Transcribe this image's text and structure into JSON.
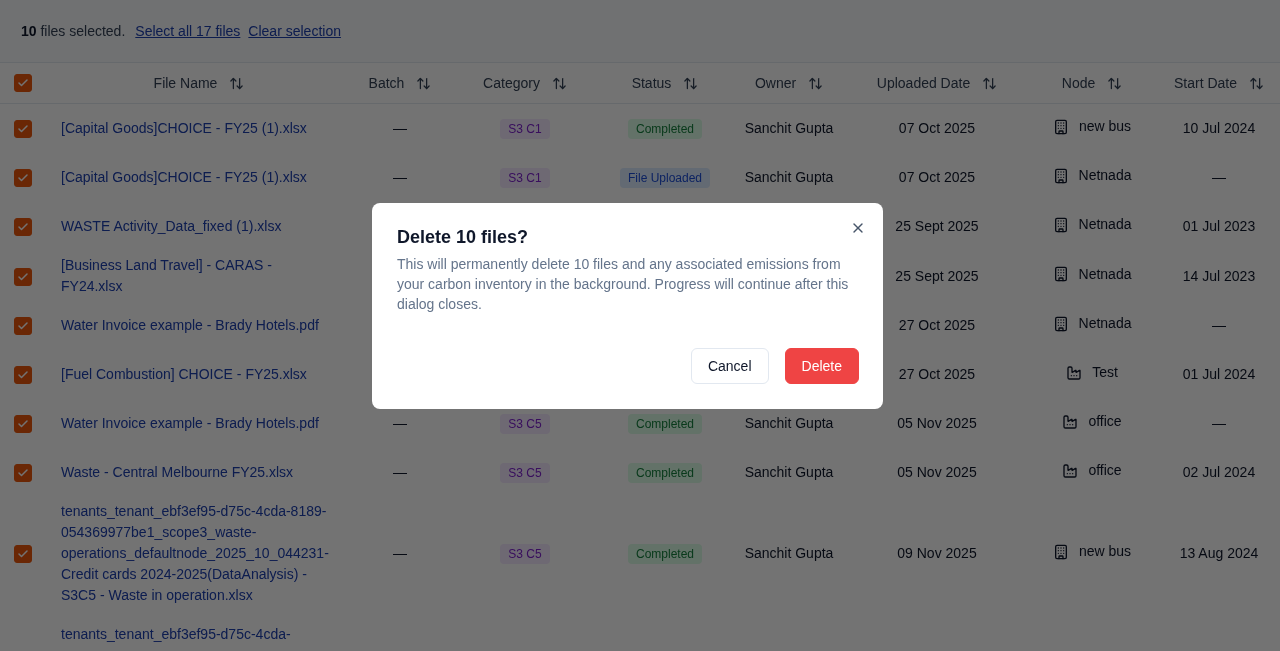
{
  "selection_bar": {
    "summary": "**10** files selected.",
    "links": [
      "Select all 17 files",
      "Clear selection"
    ]
  },
  "table": {
    "header_checked": true,
    "columns": [
      "File Name",
      "Batch",
      "Category",
      "Status",
      "Owner",
      "Uploaded Date",
      "Node",
      "Start Date"
    ],
    "rows": [
      {
        "checked": true,
        "file_name": "[Capital Goods]CHOICE - FY25 (1).xlsx",
        "batch": "—",
        "category": "S3 C1",
        "status": {
          "label": "Completed",
          "kind": "completed"
        },
        "owner": "Sanchit Gupta",
        "uploaded": "07 Oct 2025",
        "node": {
          "kind": "building",
          "label": "new bus"
        },
        "start_date": "10 Jul 2024"
      },
      {
        "checked": true,
        "file_name": "[Capital Goods]CHOICE - FY25 (1).xlsx",
        "batch": "—",
        "category": "S3 C1",
        "status": {
          "label": "File Uploaded",
          "kind": "uploaded"
        },
        "owner": "Sanchit Gupta",
        "uploaded": "07 Oct 2025",
        "node": {
          "kind": "building",
          "label": "Netnada"
        },
        "start_date": "—"
      },
      {
        "checked": true,
        "file_name": "WASTE Activity_Data_fixed (1).xlsx",
        "uploaded": "25 Sept 2025",
        "node": {
          "kind": "building",
          "label": "Netnada"
        },
        "start_date": "01 Jul 2023"
      },
      {
        "checked": true,
        "file_name": "[Business Land Travel] - CARAS - FY24.xlsx",
        "uploaded": "25 Sept 2025",
        "node": {
          "kind": "building",
          "label": "Netnada"
        },
        "start_date": "14 Jul 2023"
      },
      {
        "checked": true,
        "file_name": "Water Invoice example - Brady Hotels.pdf",
        "uploaded": "27 Oct 2025",
        "node": {
          "kind": "building",
          "label": "Netnada"
        },
        "start_date": "—"
      },
      {
        "checked": true,
        "file_name": "[Fuel Combustion] CHOICE - FY25.xlsx",
        "uploaded": "27 Oct 2025",
        "node": {
          "kind": "factory",
          "label": "Test"
        },
        "start_date": "01 Jul 2024"
      },
      {
        "checked": true,
        "file_name": "Water Invoice example - Brady Hotels.pdf",
        "batch": "—",
        "category": "S3 C5",
        "status": {
          "label": "Completed",
          "kind": "completed"
        },
        "owner": "Sanchit Gupta",
        "uploaded": "05 Nov 2025",
        "node": {
          "kind": "factory",
          "label": "office"
        },
        "start_date": "—"
      },
      {
        "checked": true,
        "file_name": "Waste - Central Melbourne FY25.xlsx",
        "batch": "—",
        "category": "S3 C5",
        "status": {
          "label": "Completed",
          "kind": "completed"
        },
        "owner": "Sanchit Gupta",
        "uploaded": "05 Nov 2025",
        "node": {
          "kind": "factory",
          "label": "office"
        },
        "start_date": "02 Jul 2024"
      },
      {
        "checked": true,
        "file_name": "tenants_tenant_ebf3ef95-d75c-4cda-8189-054369977be1_scope3_waste-operations_defaultnode_2025_10_044231-Credit cards 2024-2025(DataAnalysis) - S3C5 - Waste in operation.xlsx",
        "batch": "—",
        "category": "S3 C5",
        "status": {
          "label": "Completed",
          "kind": "completed"
        },
        "owner": "Sanchit Gupta",
        "uploaded": "09 Nov 2025",
        "node": {
          "kind": "building",
          "label": "new bus"
        },
        "start_date": "13 Aug 2024"
      },
      {
        "file_name": "tenants_tenant_ebf3ef95-d75c-4cda-"
      }
    ]
  },
  "dialog": {
    "title": "Delete 10 files?",
    "message": "This will permanently delete 10 files and any associated emissions from your carbon inventory in the background. Progress will continue after this dialog closes.",
    "buttons": [
      {
        "label": "Cancel",
        "kind": "secondary"
      },
      {
        "label": "Delete",
        "kind": "danger"
      }
    ]
  }
}
